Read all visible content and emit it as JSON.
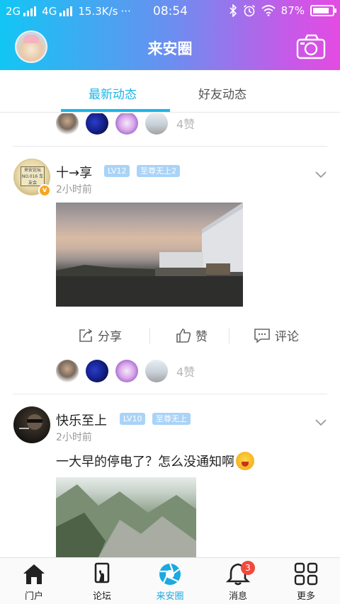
{
  "status_bar": {
    "network1": "2G",
    "network2": "4G",
    "speed": "15.3K/s",
    "more": "···",
    "time": "08:54",
    "battery": "87%"
  },
  "header": {
    "title": "来安圈"
  },
  "tabs": [
    {
      "label": "最新动态",
      "active": true
    },
    {
      "label": "好友动态",
      "active": false
    }
  ],
  "feed": {
    "top_likes": "4赞",
    "posts": [
      {
        "user": "十→享",
        "level": "LV12",
        "rank": "至尊无上2",
        "time": "2小时前",
        "avatar_text": "来安论坛 NO.016 车友会",
        "likes": "4赞"
      },
      {
        "user": "快乐至上",
        "level": "LV10",
        "rank": "至尊无上",
        "time": "2小时前",
        "text": "一大早的停电了？怎么没通知啊"
      }
    ],
    "actions": {
      "share": "分享",
      "like": "赞",
      "comment": "评论"
    }
  },
  "bottom_nav": [
    {
      "label": "门户",
      "icon": "home-icon"
    },
    {
      "label": "论坛",
      "icon": "forum-icon"
    },
    {
      "label": "来安圈",
      "icon": "aperture-icon",
      "active": true
    },
    {
      "label": "消息",
      "icon": "bell-icon",
      "badge": "3"
    },
    {
      "label": "更多",
      "icon": "grid-icon"
    }
  ],
  "colors": {
    "accent": "#1eb6e8",
    "header_gradient_start": "#12c6f4",
    "header_gradient_end": "#e44be2",
    "badge": "#a9d3f7",
    "notification": "#f2493c"
  }
}
